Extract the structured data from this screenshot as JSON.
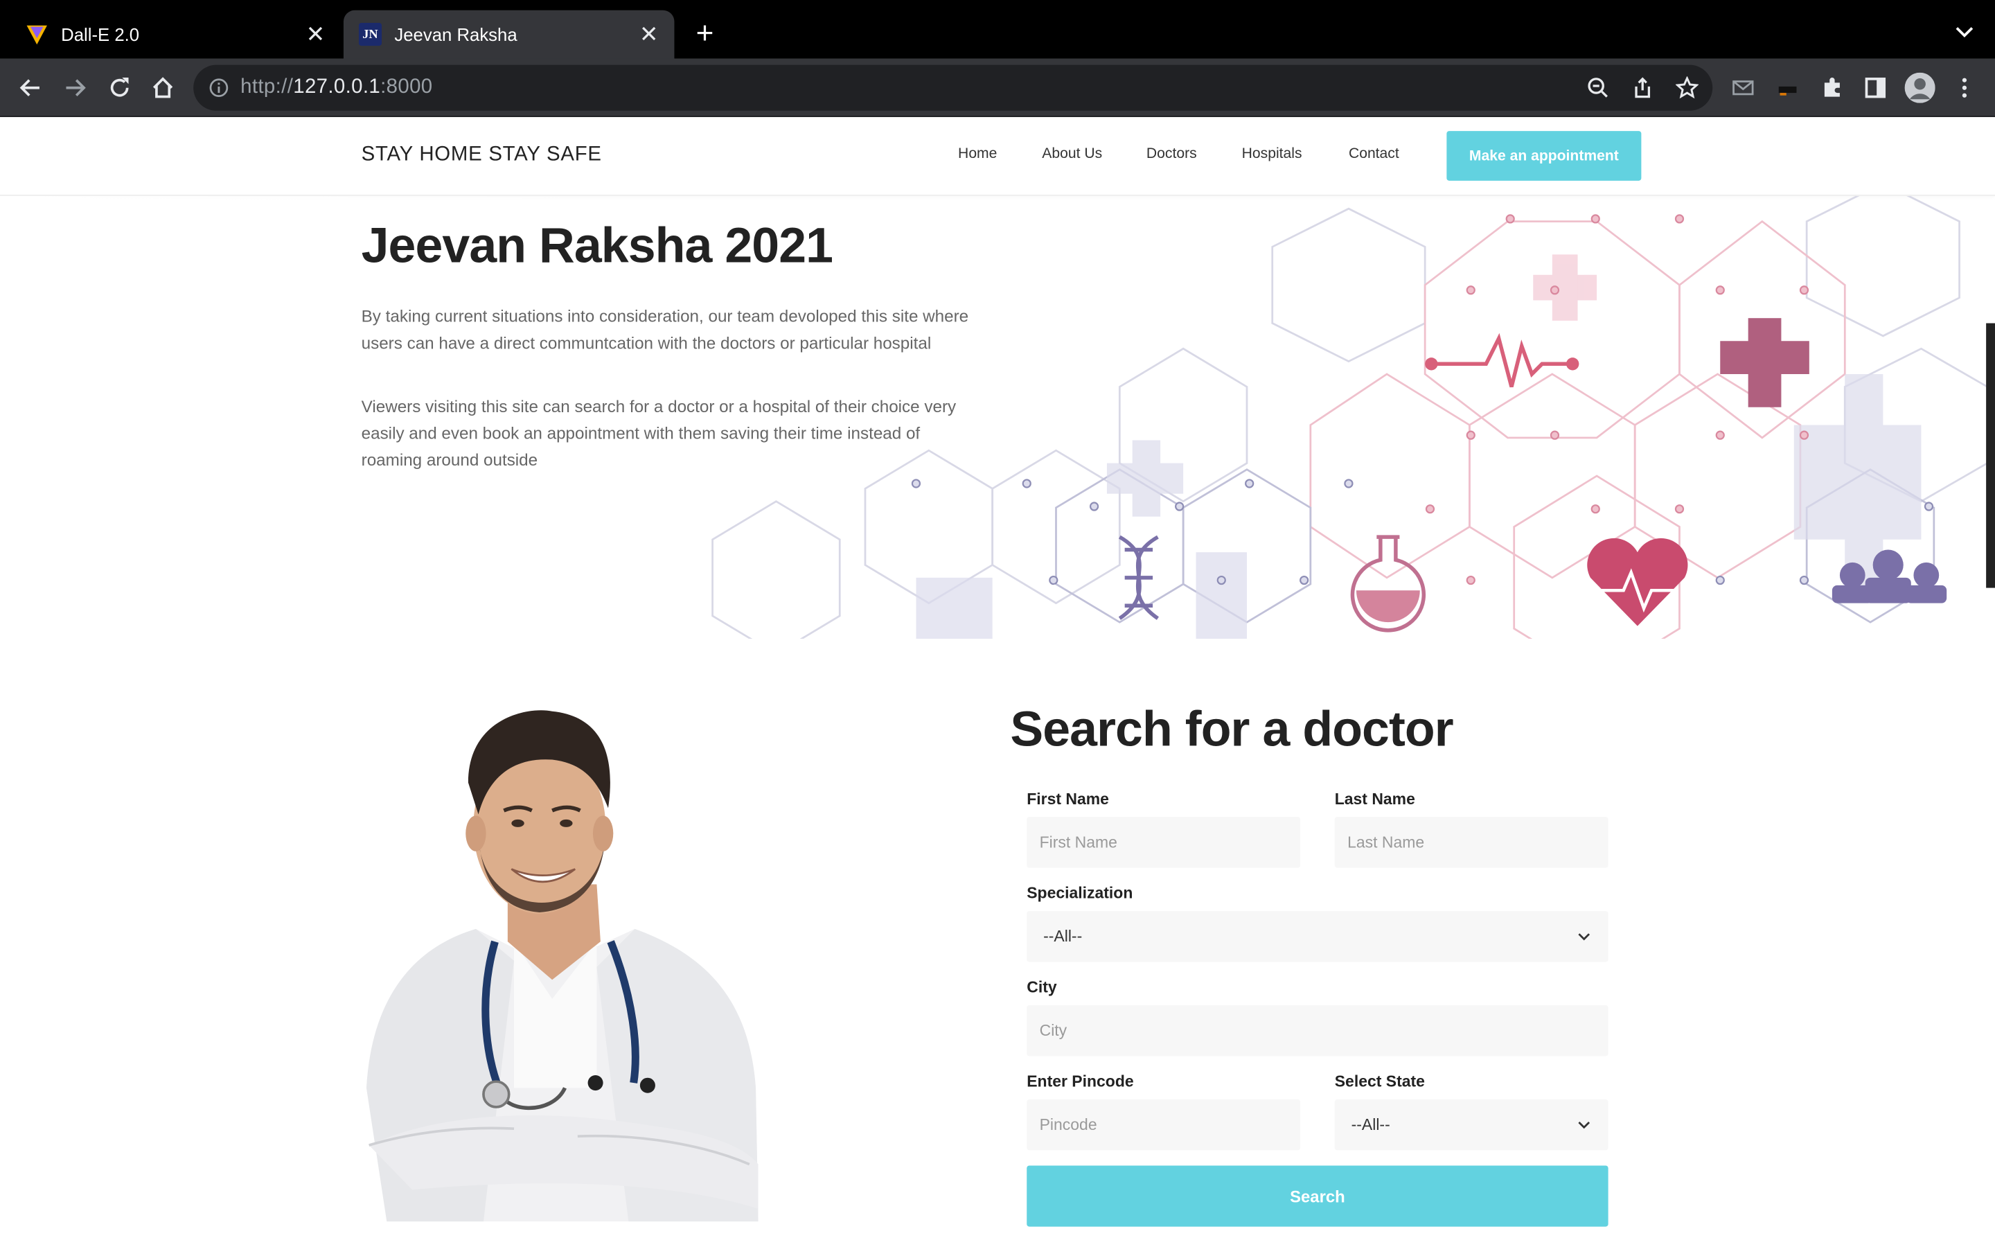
{
  "browser": {
    "tabs": [
      {
        "title": "Dall-E 2.0",
        "active": false
      },
      {
        "title": "Jeevan Raksha",
        "active": true,
        "favicon_text": "JN"
      }
    ],
    "url_scheme": "http://",
    "url_host": "127.0.0.1",
    "url_port": ":8000"
  },
  "header": {
    "brand": "STAY HOME STAY SAFE",
    "nav": [
      "Home",
      "About Us",
      "Doctors",
      "Hospitals",
      "Contact"
    ],
    "cta": "Make an appointment",
    "accent_color": "#62d2e0"
  },
  "hero": {
    "title": "Jeevan Raksha 2021",
    "paragraph1": "By taking current situations into consideration, our team devoloped this site where users can have a direct communtcation with the doctors or particular hospital",
    "paragraph2": "Viewers visiting this site can search for a doctor or a hospital of their choice very easily and even book an appointment with them saving their time instead of roaming around outside"
  },
  "search": {
    "title": "Search for a doctor",
    "first_name": {
      "label": "First Name",
      "placeholder": "First Name"
    },
    "last_name": {
      "label": "Last Name",
      "placeholder": "Last Name"
    },
    "specialization": {
      "label": "Specialization",
      "value": "--All--"
    },
    "city": {
      "label": "City",
      "placeholder": "City"
    },
    "pincode": {
      "label": "Enter Pincode",
      "placeholder": "Pincode"
    },
    "state": {
      "label": "Select State",
      "value": "--All--"
    },
    "button": "Search"
  }
}
